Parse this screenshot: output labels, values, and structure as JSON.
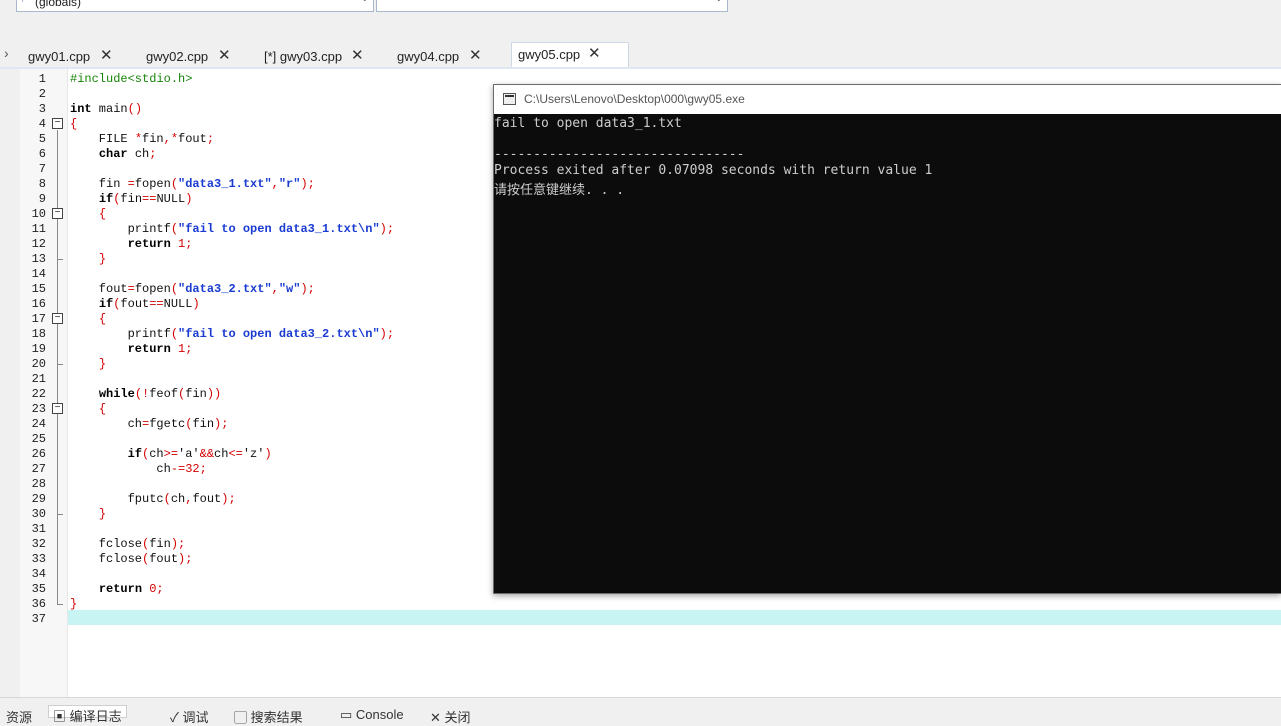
{
  "toolbar": {
    "scope_combo": "(globals)",
    "member_combo": ""
  },
  "tabs": [
    {
      "label": "gwy01.cpp"
    },
    {
      "label": "gwy02.cpp"
    },
    {
      "label": "[*] gwy03.cpp"
    },
    {
      "label": "gwy04.cpp"
    },
    {
      "label": "gwy05.cpp",
      "active": true
    }
  ],
  "code": {
    "lines": [
      "1",
      "2",
      "3",
      "4",
      "5",
      "6",
      "7",
      "8",
      "9",
      "10",
      "11",
      "12",
      "13",
      "14",
      "15",
      "16",
      "17",
      "18",
      "19",
      "20",
      "21",
      "22",
      "23",
      "24",
      "25",
      "26",
      "27",
      "28",
      "29",
      "30",
      "31",
      "32",
      "33",
      "34",
      "35",
      "36",
      "37"
    ],
    "current_line": 37
  },
  "console": {
    "title": "C:\\Users\\Lenovo\\Desktop\\000\\gwy05.exe",
    "line1": "fail to open data3_1.txt",
    "line2": "--------------------------------",
    "line3": "Process exited after 0.07098 seconds with return value 1",
    "line4": "请按任意键继续. . ."
  },
  "bottom_tabs": [
    {
      "label": "资源"
    },
    {
      "label": "编译日志"
    },
    {
      "label": "调试"
    },
    {
      "label": "搜索结果"
    },
    {
      "label": "Console"
    },
    {
      "label": "关闭"
    }
  ],
  "colors": {
    "keyword": "#000000",
    "string": "#1a3bd1",
    "operator": "#d40000",
    "preprocessor": "#18850a",
    "current_line": "#c8f4f4",
    "console_bg": "#0c0c0c"
  }
}
